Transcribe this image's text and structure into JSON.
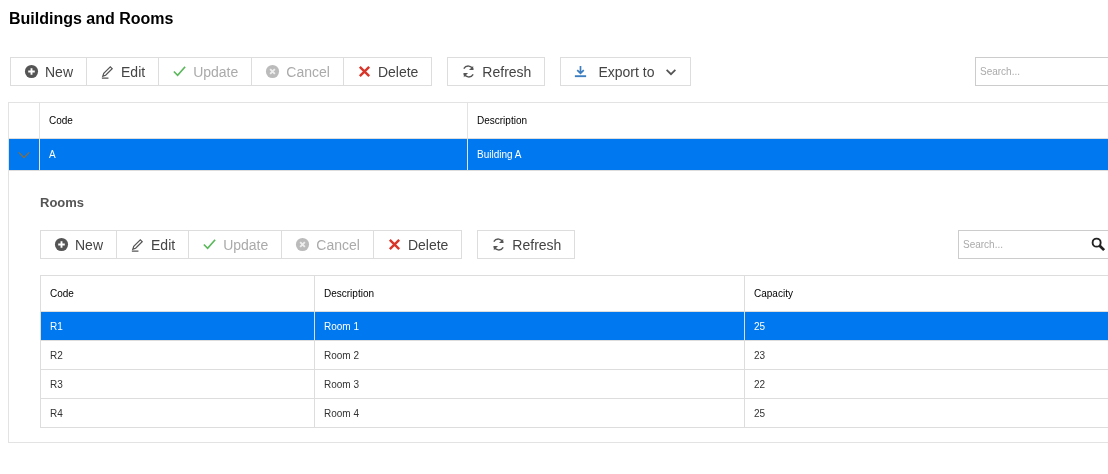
{
  "page_title": "Buildings and Rooms",
  "toolbar": {
    "groups": [
      [
        {
          "kind": "new",
          "label": "New",
          "disabled": false
        },
        {
          "kind": "edit",
          "label": "Edit",
          "disabled": false
        },
        {
          "kind": "update",
          "label": "Update",
          "disabled": true
        },
        {
          "kind": "cancel",
          "label": "Cancel",
          "disabled": true
        },
        {
          "kind": "delete",
          "label": "Delete",
          "disabled": false
        }
      ],
      [
        {
          "kind": "refresh",
          "label": "Refresh",
          "disabled": false
        }
      ],
      [
        {
          "kind": "export",
          "label": "Export to",
          "disabled": false
        }
      ]
    ],
    "search": {
      "placeholder": "Search..."
    }
  },
  "table": {
    "columns": [
      "Code",
      "Description"
    ],
    "rows": [
      {
        "cells": [
          "A",
          "Building A"
        ],
        "selected": true,
        "expanded": true
      }
    ]
  },
  "detail": {
    "title": "Rooms",
    "toolbar": {
      "groups": [
        [
          {
            "kind": "new",
            "label": "New",
            "disabled": false
          },
          {
            "kind": "edit",
            "label": "Edit",
            "disabled": false
          },
          {
            "kind": "update",
            "label": "Update",
            "disabled": true
          },
          {
            "kind": "cancel",
            "label": "Cancel",
            "disabled": true
          },
          {
            "kind": "delete",
            "label": "Delete",
            "disabled": false
          }
        ],
        [
          {
            "kind": "refresh",
            "label": "Refresh",
            "disabled": false
          }
        ]
      ],
      "search": {
        "placeholder": "Search..."
      }
    },
    "table": {
      "columns": [
        "Code",
        "Description",
        "Capacity"
      ],
      "rows": [
        {
          "cells": [
            "R1",
            "Room 1",
            "25"
          ],
          "selected": true
        },
        {
          "cells": [
            "R2",
            "Room 2",
            "23"
          ],
          "selected": false
        },
        {
          "cells": [
            "R3",
            "Room 3",
            "22"
          ],
          "selected": false
        },
        {
          "cells": [
            "R4",
            "Room 4",
            "25"
          ],
          "selected": false
        }
      ]
    }
  }
}
